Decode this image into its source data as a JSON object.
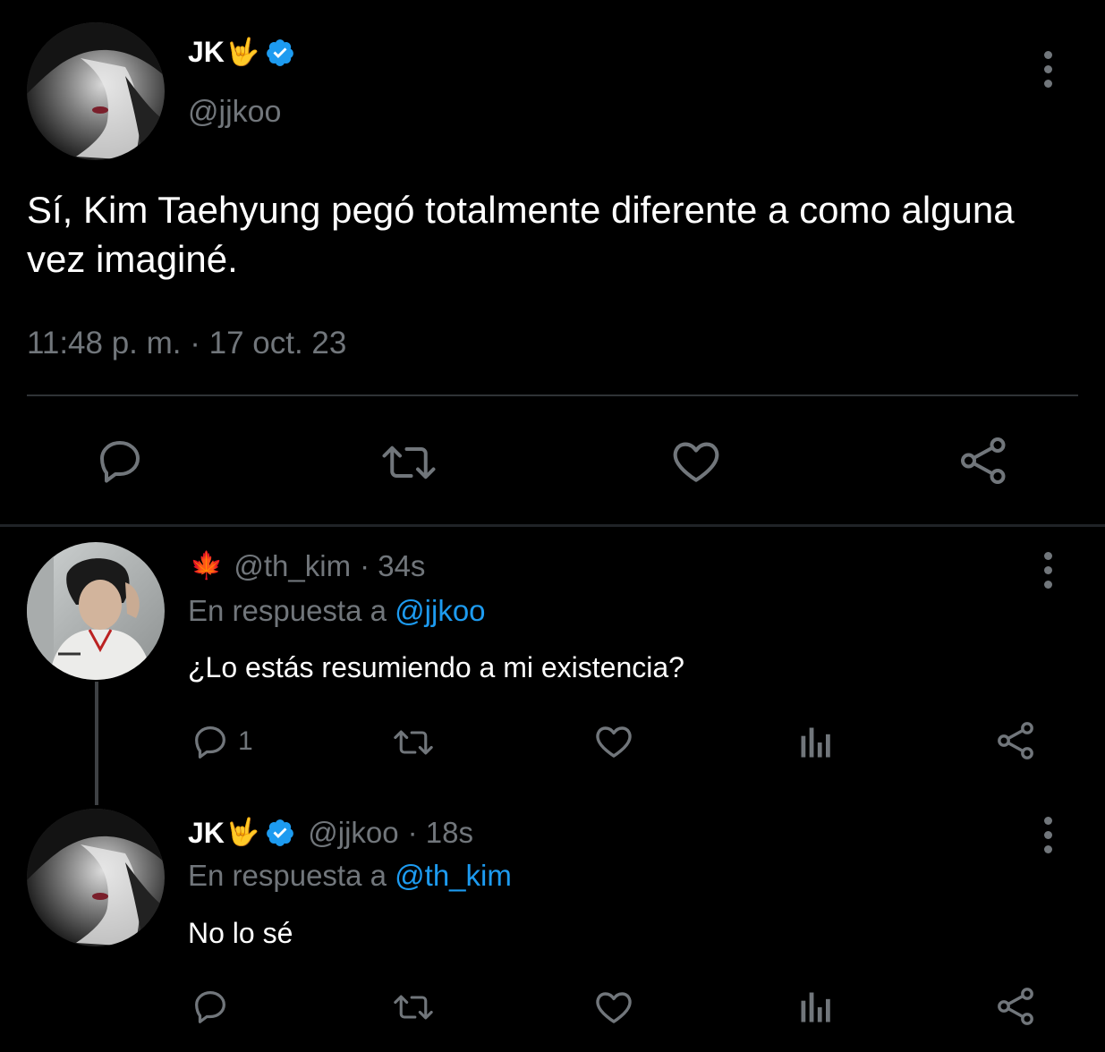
{
  "main_tweet": {
    "display_name": "JK",
    "name_emoji": "🤟",
    "handle": "@jjkoo",
    "text": "Sí, Kim Taehyung pegó totalmente diferente a como alguna vez imaginé.",
    "timestamp": "11:48 p. m. · 17 oct. 23"
  },
  "replies": [
    {
      "name_emoji": "🍁",
      "handle": "@th_kim",
      "time": "· 34s",
      "reply_prefix": "En respuesta a",
      "reply_to": "@jjkoo",
      "text": "¿Lo estás resumiendo a mi existencia?",
      "reply_count": "1"
    },
    {
      "display_name": "JK",
      "name_emoji": "🤟",
      "handle": "@jjkoo",
      "time": "· 18s",
      "reply_prefix": "En respuesta a",
      "reply_to": "@th_kim",
      "text": "No lo sé"
    }
  ],
  "icons": {
    "verified": "verified-badge-icon",
    "more": "more-vertical-icon",
    "reply": "reply-bubble-icon",
    "retweet": "retweet-icon",
    "like": "heart-icon",
    "views": "views-bar-icon",
    "share": "share-icon"
  },
  "colors": {
    "background": "#000000",
    "text_primary": "#e7e9ea",
    "text_secondary": "#71767b",
    "accent": "#1d9bf0",
    "divider": "#2f3336"
  }
}
